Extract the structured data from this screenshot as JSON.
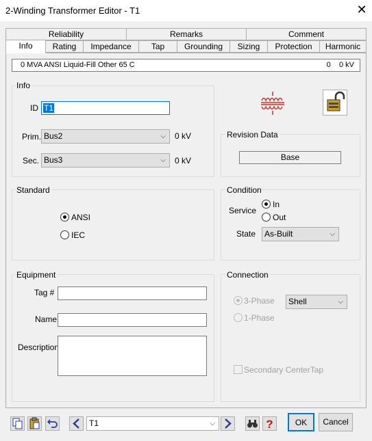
{
  "window": {
    "title": "2-Winding Transformer Editor - T1",
    "close_label": "✕"
  },
  "tabs": {
    "row1": [
      "Reliability",
      "Remarks",
      "Comment"
    ],
    "row2": [
      "Info",
      "Rating",
      "Impedance",
      "Tap",
      "Grounding",
      "Sizing",
      "Protection",
      "Harmonic"
    ]
  },
  "infobar": {
    "left": "0 MVA  ANSI  Liquid-Fill  Other  65 C",
    "right": "0    0 kV"
  },
  "info": {
    "group_label": "Info",
    "id_label": "ID",
    "id_value": "T1",
    "prim_label": "Prim.",
    "prim_value": "Bus2",
    "prim_kv": "0 kV",
    "sec_label": "Sec.",
    "sec_value": "Bus3",
    "sec_kv": "0 kV"
  },
  "revision": {
    "group_label": "Revision Data",
    "value": "Base"
  },
  "standard": {
    "group_label": "Standard",
    "options": [
      "ANSI",
      "IEC"
    ],
    "selected": "ANSI"
  },
  "condition": {
    "group_label": "Condition",
    "service_label": "Service",
    "service_options": [
      "In",
      "Out"
    ],
    "service_selected": "In",
    "state_label": "State",
    "state_value": "As-Built"
  },
  "equipment": {
    "group_label": "Equipment",
    "tag_label": "Tag #",
    "tag_value": "",
    "name_label": "Name",
    "name_value": "",
    "description_label": "Description",
    "description_value": ""
  },
  "connection": {
    "group_label": "Connection",
    "phase_options": [
      "3-Phase",
      "1-Phase"
    ],
    "phase_selected": "3-Phase",
    "type_value": "Shell",
    "centertap_label": "Secondary CenterTap"
  },
  "footer": {
    "element_value": "T1",
    "ok_label": "OK",
    "cancel_label": "Cancel"
  },
  "colors": {
    "transformer_icon": "#c0392b",
    "window_bg": "#f0f0f0",
    "nav_arrow": "#2b3a9c"
  }
}
